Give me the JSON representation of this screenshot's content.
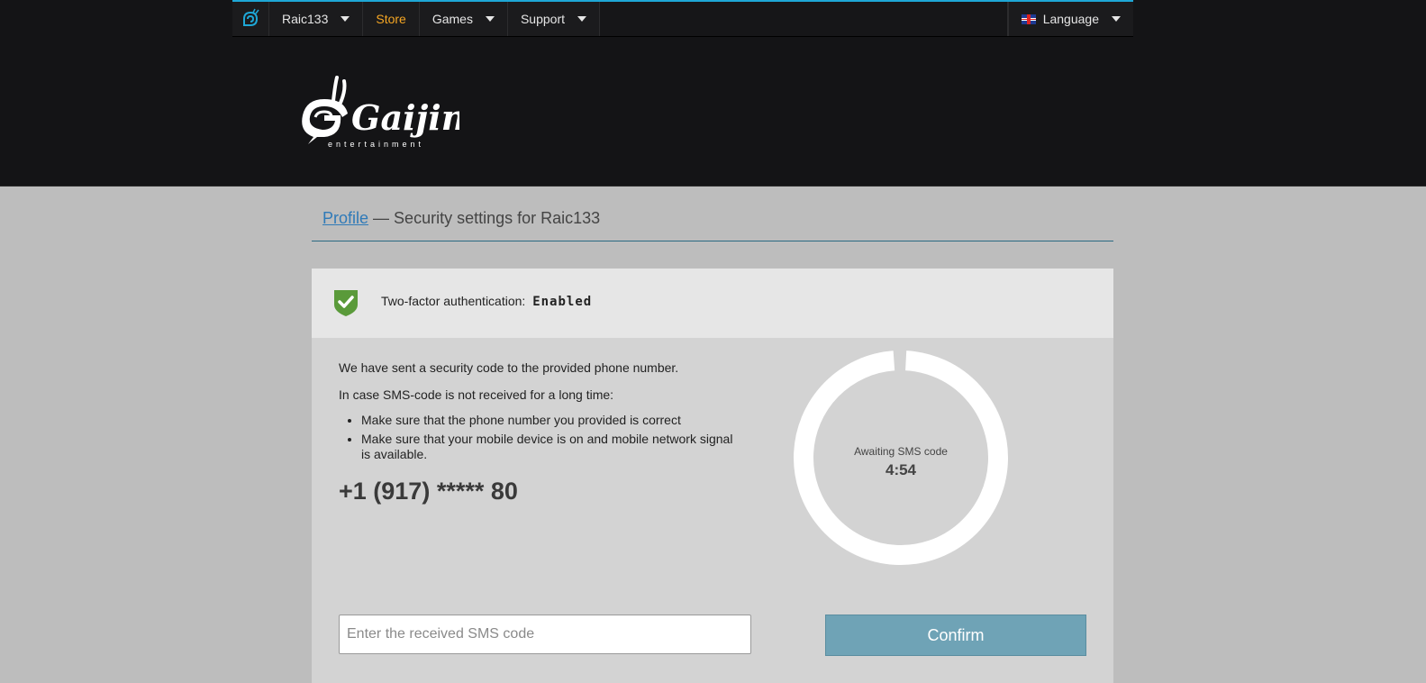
{
  "nav": {
    "user_label": "Raic133",
    "store_label": "Store",
    "games_label": "Games",
    "support_label": "Support",
    "language_label": "Language"
  },
  "brand": {
    "name": "Gaijin",
    "tagline": "entertainment"
  },
  "breadcrumb": {
    "profile_link": "Profile",
    "separator": " — ",
    "title": "Security settings for Raic133"
  },
  "tfa": {
    "label": "Two-factor authentication:",
    "status": "Enabled"
  },
  "message": {
    "sent": "We have sent a security code to the provided phone number.",
    "not_received": "In case SMS-code is not received for a long time:",
    "tips": [
      "Make sure that the phone number you provided is correct",
      "Make sure that your mobile device is on and mobile network signal is available."
    ],
    "phone": "+1 (917) ***** 80"
  },
  "timer": {
    "label": "Awaiting SMS code",
    "value": "4:54",
    "progress_fraction": 0.98
  },
  "form": {
    "placeholder": "Enter the received SMS code",
    "confirm_label": "Confirm"
  },
  "colors": {
    "accent": "#1ea7d6",
    "store": "#f5a623",
    "link": "#2f7ab8",
    "shield": "#5a9a3a",
    "confirm": "#6fa3b6"
  }
}
